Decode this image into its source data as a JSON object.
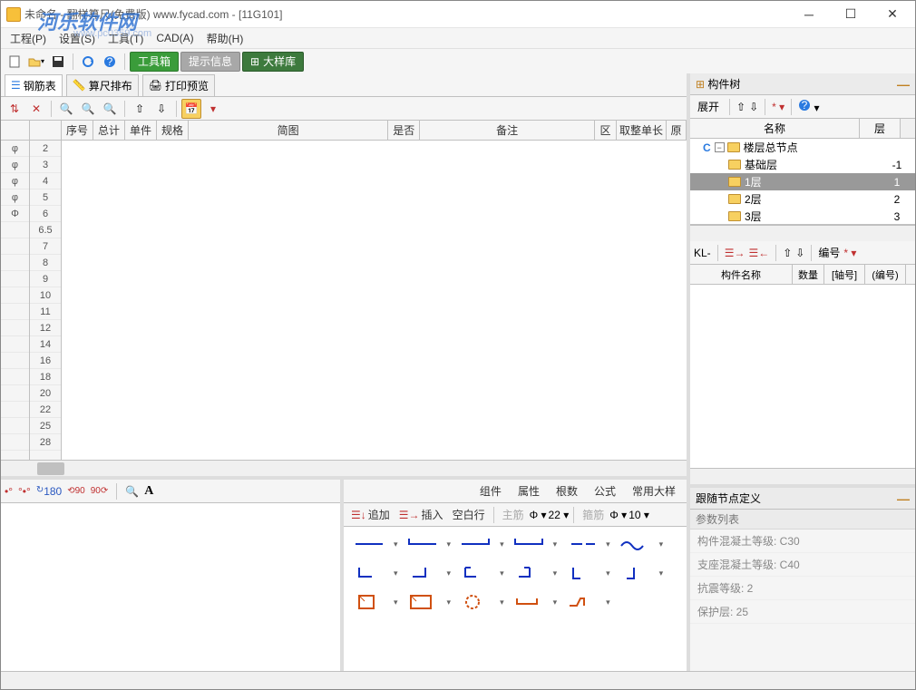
{
  "title": "未命名 - 翻样算尺(免费版)  www.fycad.com - [11G101]",
  "watermark": "河乐软件网",
  "watermark_sub": "www.pc0359.com",
  "menu": {
    "file": "工程(P)",
    "settings": "设置(S)",
    "tools": "工具(T)",
    "cad": "CAD(A)",
    "help": "帮助(H)"
  },
  "bigButtons": {
    "toolbox": "工具箱",
    "hint": "提示信息",
    "detail": "大样库"
  },
  "leftTabs": {
    "rebar": "钢筋表",
    "ruler": "算尺排布",
    "print": "打印预览"
  },
  "gridHeaders": {
    "num": "序号",
    "total": "总计",
    "unit": "单件",
    "spec": "规格",
    "diagram": "简图",
    "yn": "是否",
    "note": "备注",
    "zone": "区",
    "round": "取整单长",
    "orig": "原"
  },
  "rowNums": [
    "2",
    "3",
    "4",
    "5",
    "6",
    "6.5",
    "7",
    "8",
    "9",
    "10",
    "11",
    "12",
    "14",
    "16",
    "18",
    "20",
    "22",
    "25",
    "28"
  ],
  "rowMarks": [
    "φ",
    "φ",
    "φ",
    "φ",
    "Φ"
  ],
  "lowerTabs": {
    "component": "组件",
    "property": "属性",
    "count": "根数",
    "formula": "公式",
    "common": "常用大样"
  },
  "editRow": {
    "append": "追加",
    "insert": "插入",
    "blank": "空白行",
    "main": "主筋",
    "val1": "22",
    "hoop": "箍筋",
    "val2": "10"
  },
  "rightPanel": {
    "title": "构件树",
    "expand": "展开",
    "star": "*"
  },
  "treeHeaders": {
    "name": "名称",
    "floor": "层"
  },
  "treeRoot": "楼层总节点",
  "treeItems": [
    {
      "name": "基础层",
      "floor": "-1"
    },
    {
      "name": "1层",
      "floor": "1",
      "sel": true
    },
    {
      "name": "2层",
      "floor": "2"
    },
    {
      "name": "3层",
      "floor": "3"
    }
  ],
  "kl": {
    "label": "KL-",
    "id": "编号",
    "star": "*"
  },
  "kHeaders": {
    "name": "构件名称",
    "qty": "数量",
    "axis": "[轴号]",
    "code": "(编号)"
  },
  "defPanel": {
    "title": "跟随节点定义",
    "params": "参数列表"
  },
  "params": {
    "concrete": "构件混凝土等级: C30",
    "support": "支座混凝土等级: C40",
    "seismic": "抗震等级: 2",
    "cover": "保护层: 25"
  }
}
